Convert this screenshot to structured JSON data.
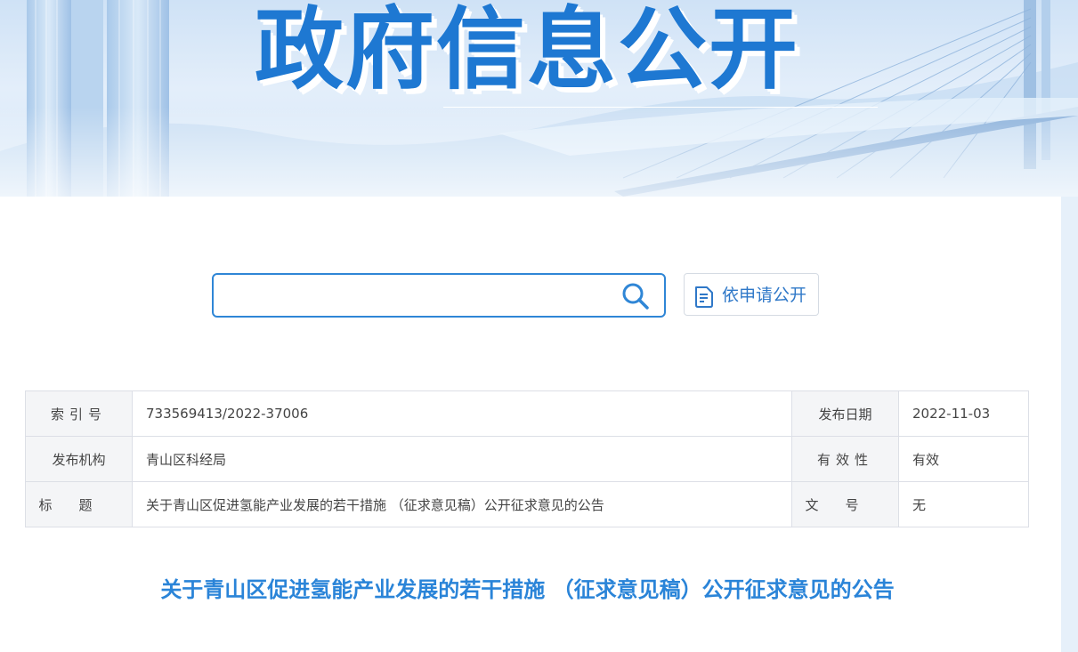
{
  "banner": {
    "title": "政府信息公开"
  },
  "search": {
    "value": "",
    "placeholder": ""
  },
  "apply_button": {
    "label": "依申请公开",
    "icon": "document-icon"
  },
  "meta_table": {
    "index_label": "索引号",
    "index_value": "733569413/2022-37006",
    "date_label": "发布日期",
    "date_value": "2022-11-03",
    "org_label": "发布机构",
    "org_value": "青山区科经局",
    "validity_label": "有效性",
    "validity_value": "有效",
    "title_label": "标题",
    "title_value": "关于青山区促进氢能产业发展的若干措施 （征求意见稿）公开征求意见的公告",
    "docno_label": "文号",
    "docno_value": "无"
  },
  "article": {
    "title": "关于青山区促进氢能产业发展的若干措施 （征求意见稿）公开征求意见的公告"
  },
  "colors": {
    "accent": "#2f86d6",
    "title_blue": "#1e78d2",
    "article_title": "#2a84d8"
  }
}
